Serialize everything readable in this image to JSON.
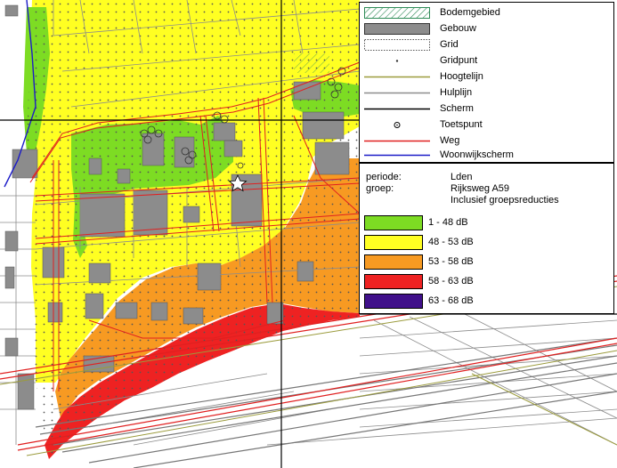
{
  "legend": {
    "items": [
      {
        "label": "Bodemgebied",
        "symbol": "hatched-area"
      },
      {
        "label": "Gebouw",
        "symbol": "grey-fill"
      },
      {
        "label": "Grid",
        "symbol": "dotted-rect"
      },
      {
        "label": "Gridpunt",
        "symbol": "small-dot"
      },
      {
        "label": "Hoogtelijn",
        "symbol": "olive-line",
        "color": "#9b9b3c"
      },
      {
        "label": "Hulplijn",
        "symbol": "grey-line",
        "color": "#8c8c8c"
      },
      {
        "label": "Scherm",
        "symbol": "black-line",
        "color": "#000000"
      },
      {
        "label": "Toetspunt",
        "symbol": "circle-point"
      },
      {
        "label": "Weg",
        "symbol": "red-line",
        "color": "#e02020"
      },
      {
        "label": "Woonwijkscherm",
        "symbol": "blue-line",
        "color": "#1c1cc8"
      }
    ]
  },
  "info": {
    "periode_label": "periode:",
    "periode_value": "Lden",
    "groep_label": "groep:",
    "groep_value": "Rijksweg A59",
    "groep_note": "Inclusief groepsreducties"
  },
  "bands": [
    {
      "label": "1 - 48 dB",
      "color": "#7ddc23"
    },
    {
      "label": "48 - 53 dB",
      "color": "#ffff22"
    },
    {
      "label": "53 - 58 dB",
      "color": "#f79a22"
    },
    {
      "label": "58 - 63 dB",
      "color": "#ee2222"
    },
    {
      "label": "63 - 68 dB",
      "color": "#40108a"
    }
  ]
}
